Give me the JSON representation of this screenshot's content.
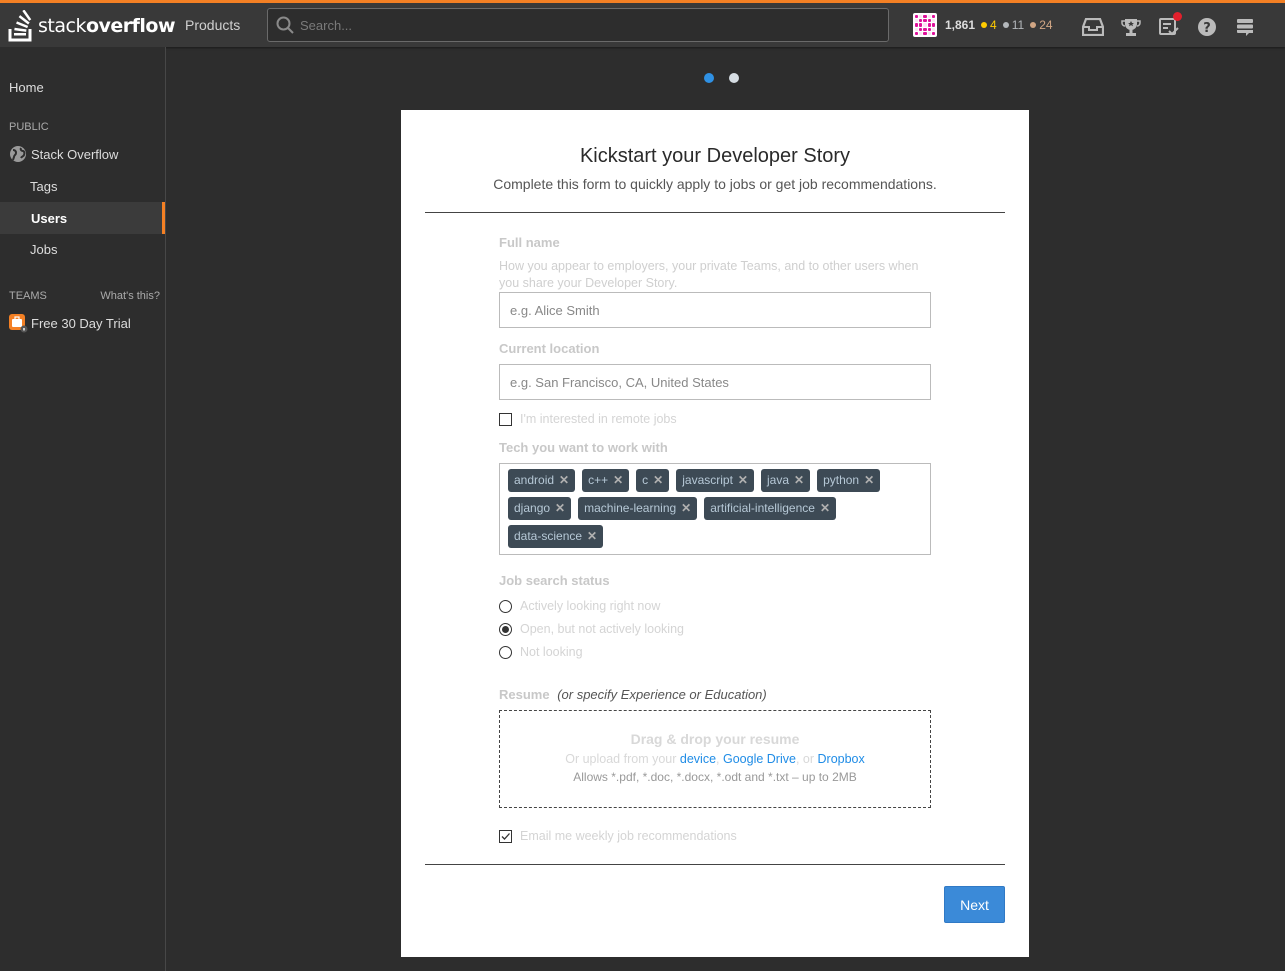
{
  "topbar": {
    "logo_light": "stack",
    "logo_bold": "overflow",
    "products_label": "Products",
    "search_placeholder": "Search...",
    "reputation": "1,861",
    "badges": {
      "gold": {
        "count": "4",
        "color": "#ffcc01"
      },
      "silver": {
        "count": "11",
        "color": "#b4b8bc"
      },
      "bronze": {
        "count": "24",
        "color": "#d1a684"
      }
    },
    "icons": [
      "inbox-icon",
      "achievements-icon",
      "review-queue-icon",
      "help-icon",
      "site-switcher-icon"
    ],
    "review_has_notification": true
  },
  "sidebar": {
    "home": "Home",
    "public_heading": "PUBLIC",
    "stack_overflow": "Stack Overflow",
    "tags": "Tags",
    "users": "Users",
    "jobs": "Jobs",
    "teams_heading": "TEAMS",
    "whats_this": "What's this?",
    "free_trial": "Free 30 Day Trial",
    "active_item": "Users"
  },
  "pager": {
    "total": 2,
    "current": 1,
    "active_color": "#2f91e4",
    "inactive_color": "#d6dde3"
  },
  "form": {
    "title": "Kickstart your Developer Story",
    "subtitle": "Complete this form to quickly apply to jobs or get job recommendations.",
    "full_name": {
      "label": "Full name",
      "hint": "How you appear to employers, your private Teams, and to other users when you share your Developer Story.",
      "placeholder": "e.g. Alice Smith",
      "value": ""
    },
    "location": {
      "label": "Current location",
      "placeholder": "e.g. San Francisco, CA, United States",
      "value": ""
    },
    "remote": {
      "label": "I'm interested in remote jobs",
      "checked": false
    },
    "tech": {
      "label": "Tech you want to work with",
      "tags": [
        "android",
        "c++",
        "c",
        "javascript",
        "java",
        "python",
        "django",
        "machine-learning",
        "artificial-intelligence",
        "data-science"
      ]
    },
    "job_status": {
      "label": "Job search status",
      "options": [
        "Actively looking right now",
        "Open, but not actively looking",
        "Not looking"
      ],
      "selected": 1
    },
    "resume": {
      "label": "Resume",
      "alt": "(or specify Experience or Education)",
      "drop_title": "Drag & drop your resume",
      "upload_prefix": "Or upload from your",
      "device": "device",
      "sep1": ",",
      "google_drive": "Google Drive",
      "sep2": ", or",
      "dropbox": "Dropbox",
      "allows": "Allows *.pdf, *.doc, *.docx, *.odt and *.txt – up to 2MB"
    },
    "email_recs": {
      "label": "Email me weekly job recommendations",
      "checked": true
    },
    "next_label": "Next"
  }
}
